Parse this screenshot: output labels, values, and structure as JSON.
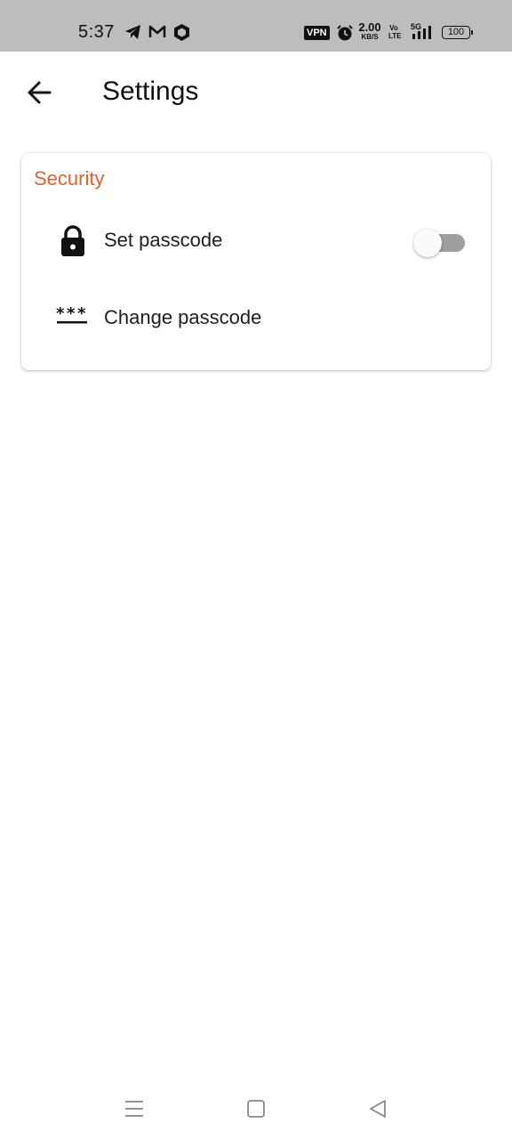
{
  "status_bar": {
    "time": "5:37",
    "notification_icons": [
      "telegram-icon",
      "gmail-icon",
      "shield-app-icon"
    ],
    "vpn_label": "VPN",
    "network_speed_value": "2.00",
    "network_speed_unit": "KB/S",
    "volte_top": "Vo",
    "volte_bottom": "LTE",
    "network_type": "5G",
    "battery_level": "100"
  },
  "app_bar": {
    "title": "Settings",
    "back_icon": "arrow-left-icon"
  },
  "security_section": {
    "title": "Security",
    "items": [
      {
        "label": "Set passcode",
        "icon": "lock-icon",
        "toggle_on": false
      },
      {
        "label": "Change passcode",
        "icon": "password-icon"
      }
    ]
  },
  "nav_bar": {
    "buttons": [
      "menu-icon",
      "home-square-icon",
      "back-triangle-icon"
    ]
  },
  "colors": {
    "accent": "#e0622d",
    "status_bar_bg": "#bdbdbd",
    "toggle_track_off": "#9e9e9e"
  }
}
